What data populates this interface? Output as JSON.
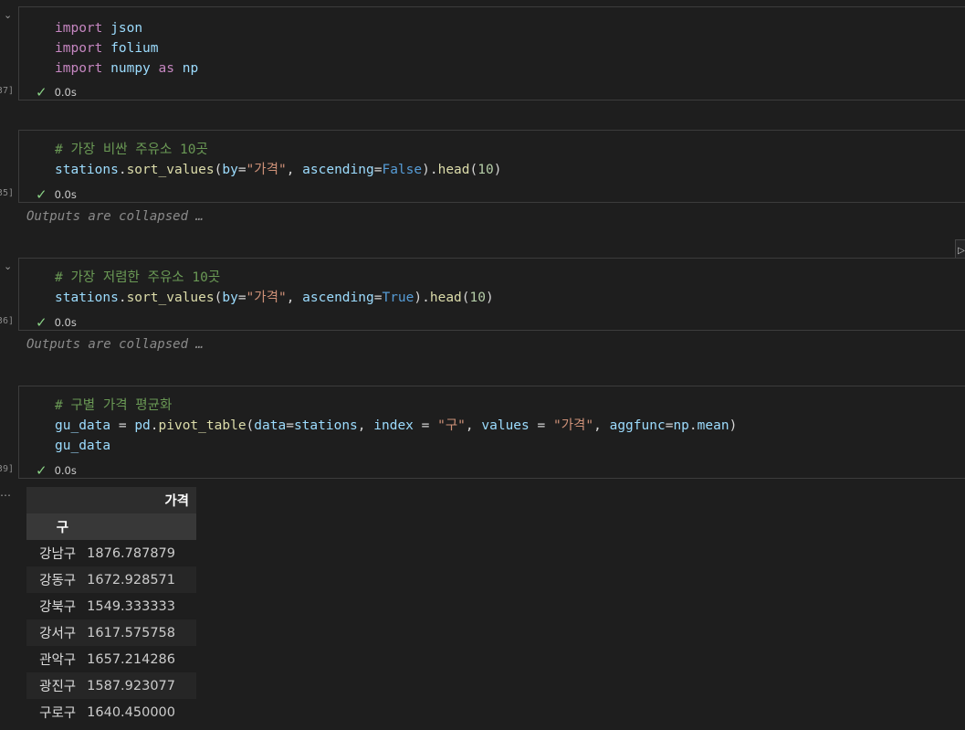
{
  "cells": [
    {
      "exec": "[37]",
      "time": "0.0s",
      "lines": [
        [
          [
            "kw",
            "import"
          ],
          [
            "pn",
            " "
          ],
          [
            "id",
            "json"
          ]
        ],
        [
          [
            "kw",
            "import"
          ],
          [
            "pn",
            " "
          ],
          [
            "id",
            "folium"
          ]
        ],
        [
          [
            "kw",
            "import"
          ],
          [
            "pn",
            " "
          ],
          [
            "id",
            "numpy"
          ],
          [
            "pn",
            " "
          ],
          [
            "kw",
            "as"
          ],
          [
            "pn",
            " "
          ],
          [
            "id",
            "np"
          ]
        ]
      ]
    },
    {
      "exec": "[35]",
      "time": "0.0s",
      "collapsed": "Outputs are collapsed …",
      "lines": [
        [
          [
            "cm",
            "# 가장 비싼 주유소 10곳"
          ]
        ],
        [
          [
            "id",
            "stations"
          ],
          [
            "pn",
            "."
          ],
          [
            "fn",
            "sort_values"
          ],
          [
            "pn",
            "("
          ],
          [
            "id",
            "by"
          ],
          [
            "pn",
            "="
          ],
          [
            "str",
            "\"가격\""
          ],
          [
            "pn",
            ", "
          ],
          [
            "id",
            "ascending"
          ],
          [
            "pn",
            "="
          ],
          [
            "bool",
            "False"
          ],
          [
            "pn",
            ")."
          ],
          [
            "fn",
            "head"
          ],
          [
            "pn",
            "("
          ],
          [
            "num",
            "10"
          ],
          [
            "pn",
            ")"
          ]
        ]
      ]
    },
    {
      "exec": "[36]",
      "time": "0.0s",
      "collapsed": "Outputs are collapsed …",
      "lines": [
        [
          [
            "cm",
            "# 가장 저렴한 주유소 10곳"
          ]
        ],
        [
          [
            "id",
            "stations"
          ],
          [
            "pn",
            "."
          ],
          [
            "fn",
            "sort_values"
          ],
          [
            "pn",
            "("
          ],
          [
            "id",
            "by"
          ],
          [
            "pn",
            "="
          ],
          [
            "str",
            "\"가격\""
          ],
          [
            "pn",
            ", "
          ],
          [
            "id",
            "ascending"
          ],
          [
            "pn",
            "="
          ],
          [
            "bool",
            "True"
          ],
          [
            "pn",
            ")."
          ],
          [
            "fn",
            "head"
          ],
          [
            "pn",
            "("
          ],
          [
            "num",
            "10"
          ],
          [
            "pn",
            ")"
          ]
        ]
      ]
    },
    {
      "exec": "[39]",
      "time": "0.0s",
      "lines": [
        [
          [
            "cm",
            "# 구별 가격 평균화"
          ]
        ],
        [
          [
            "id",
            "gu_data"
          ],
          [
            "pn",
            " = "
          ],
          [
            "id",
            "pd"
          ],
          [
            "pn",
            "."
          ],
          [
            "fn",
            "pivot_table"
          ],
          [
            "pn",
            "("
          ],
          [
            "id",
            "data"
          ],
          [
            "pn",
            "="
          ],
          [
            "id",
            "stations"
          ],
          [
            "pn",
            ", "
          ],
          [
            "id",
            "index"
          ],
          [
            "pn",
            " = "
          ],
          [
            "str",
            "\"구\""
          ],
          [
            "pn",
            ", "
          ],
          [
            "id",
            "values"
          ],
          [
            "pn",
            " = "
          ],
          [
            "str",
            "\"가격\""
          ],
          [
            "pn",
            ", "
          ],
          [
            "id",
            "aggfunc"
          ],
          [
            "pn",
            "="
          ],
          [
            "id",
            "np"
          ],
          [
            "pn",
            "."
          ],
          [
            "id",
            "mean"
          ],
          [
            "pn",
            ")"
          ]
        ],
        [
          [
            "id",
            "gu_data"
          ]
        ]
      ]
    }
  ],
  "table": {
    "column_header": "가격",
    "index_name": "구",
    "rows": [
      {
        "idx": "강남구",
        "val": "1876.787879"
      },
      {
        "idx": "강동구",
        "val": "1672.928571"
      },
      {
        "idx": "강북구",
        "val": "1549.333333"
      },
      {
        "idx": "강서구",
        "val": "1617.575758"
      },
      {
        "idx": "관악구",
        "val": "1657.214286"
      },
      {
        "idx": "광진구",
        "val": "1587.923077"
      },
      {
        "idx": "구로구",
        "val": "1640.450000"
      }
    ]
  },
  "icons": {
    "check": "check-icon",
    "chevron": "chevron-down-icon",
    "lightbulb": "lightbulb-icon"
  }
}
